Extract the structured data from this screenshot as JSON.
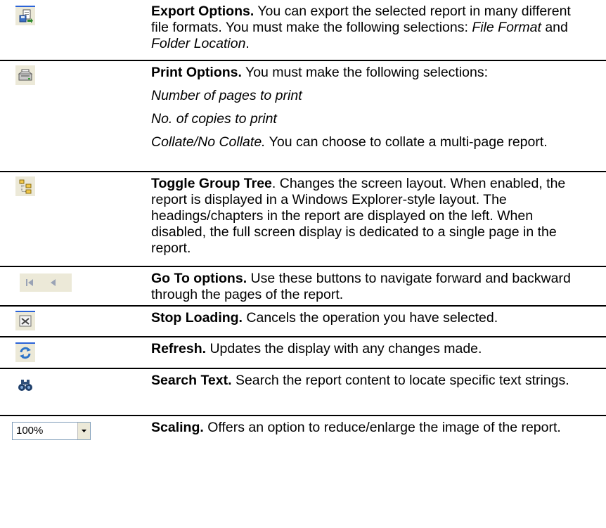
{
  "rows": [
    {
      "icon": "export-icon",
      "title": "Export Options.",
      "t1": " You can export the selected report in many different file formats.  You must make the following selections: ",
      "em1": "File Format",
      "t2": " and ",
      "em2": "Folder Location",
      "t3": "."
    },
    {
      "icon": "print-icon",
      "title": "Print Options.",
      "t1": "  You must make the following selections:",
      "line2": "Number of pages to print",
      "line3": "No. of copies to print",
      "line4_em": "Collate/No Collate.",
      "line4_rest": "  You can choose to collate a multi-page report."
    },
    {
      "icon": "group-tree-icon",
      "title": "Toggle Group Tree",
      "t1": ". Changes the screen layout.  When enabled, the report is displayed in a Windows Explorer-style layout.  The headings/chapters in the report are displayed on the left.  When disabled, the full screen display is dedicated to a single page in the report."
    },
    {
      "icon": "first-prev-page-icon",
      "title": "Go To options.",
      "t1": "  Use these buttons to navigate forward and backward through the pages of the report."
    },
    {
      "icon": "stop-loading-icon",
      "title": "Stop Loading.",
      "t1": "  Cancels the operation you have selected."
    },
    {
      "icon": "refresh-icon",
      "title": "Refresh.",
      "t1": "  Updates the display with any changes made."
    },
    {
      "icon": "binoculars-icon",
      "title": "Search Text.",
      "t1": "  Search the report content to locate specific text strings."
    },
    {
      "icon": "zoom-dropdown",
      "zoom_value": "100%",
      "title": "Scaling.",
      "t1": "  Offers an option to reduce/enlarge the image of the report."
    }
  ]
}
